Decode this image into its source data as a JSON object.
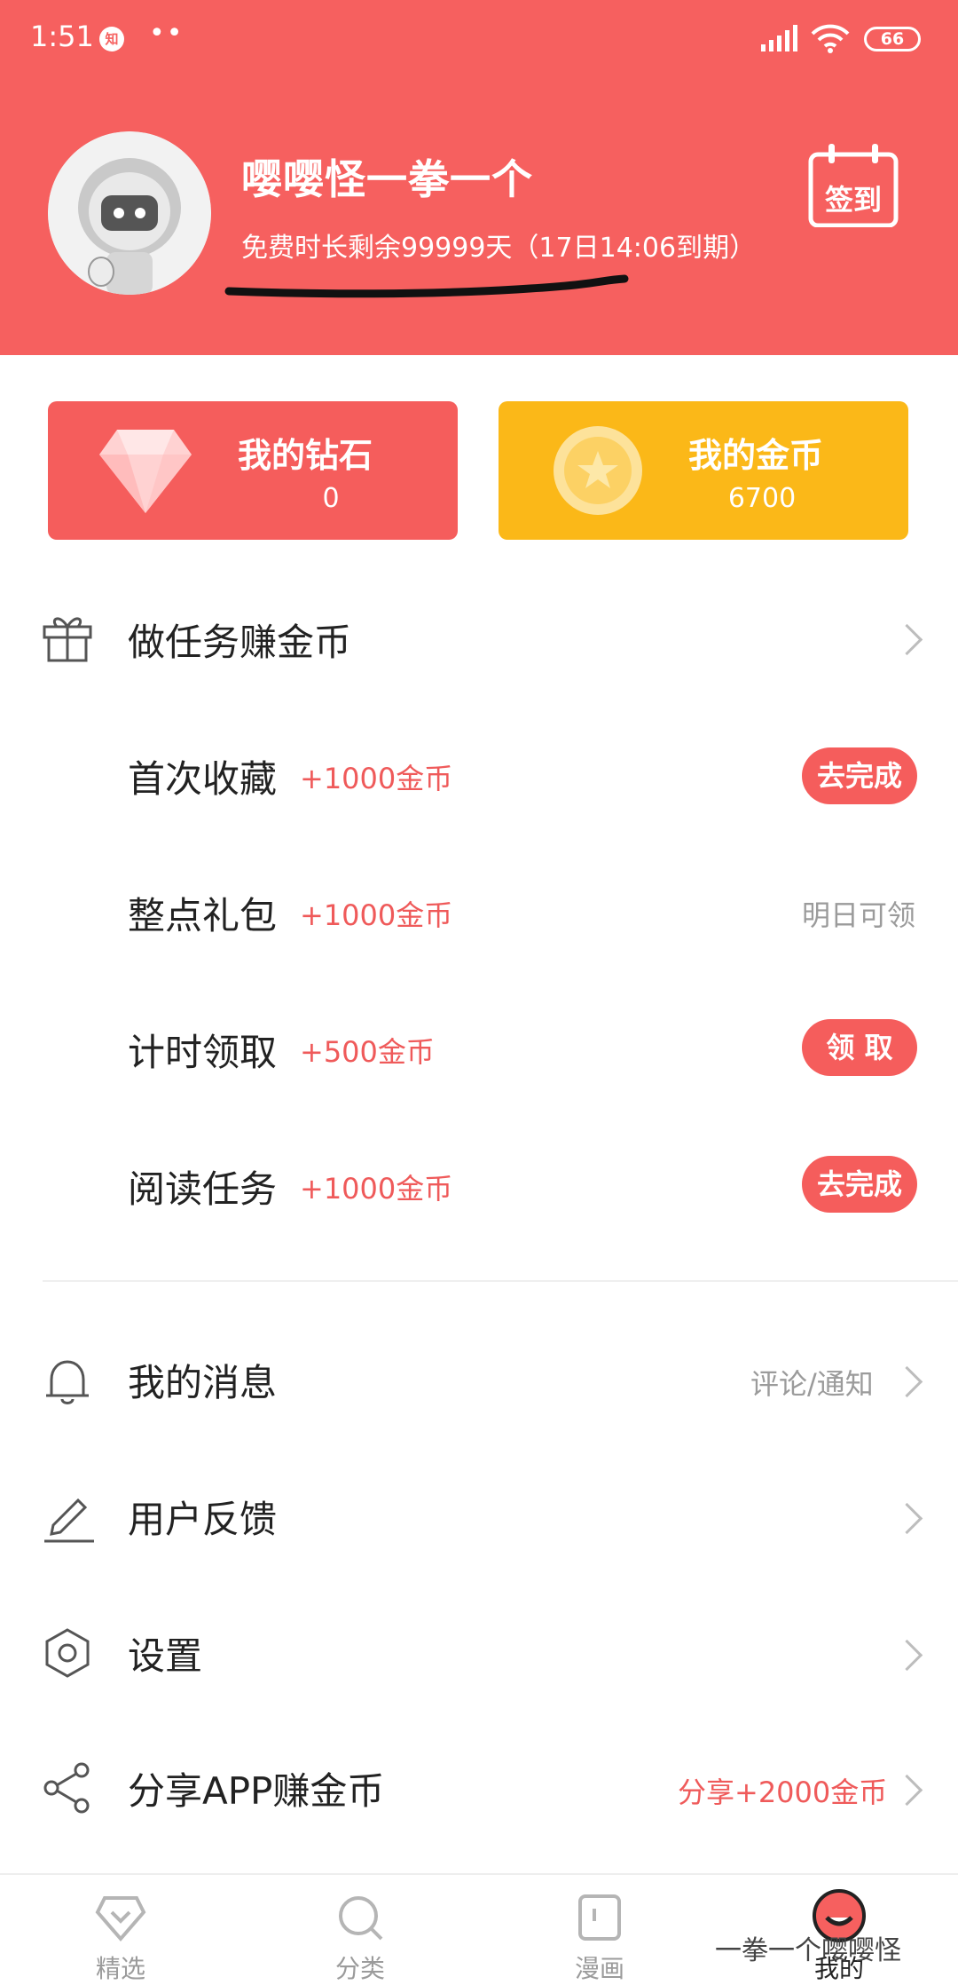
{
  "status_bar": {
    "time": "1:51",
    "badge": "知",
    "dots": "••",
    "battery": "66"
  },
  "profile": {
    "username": "嘤嘤怪一拳一个",
    "expiry": "免费时长剩余99999天（17日14:06到期）",
    "signin_label": "签到"
  },
  "wallet": {
    "diamond": {
      "title": "我的钻石",
      "value": "0"
    },
    "coin": {
      "title": "我的金币",
      "value": "6700"
    }
  },
  "tasks": {
    "header": "做任务赚金币",
    "items": [
      {
        "name": "首次收藏",
        "reward": "+1000金币",
        "action": "去完成"
      },
      {
        "name": "整点礼包",
        "reward": "+1000金币",
        "status": "明日可领"
      },
      {
        "name": "计时领取",
        "reward": "+500金币",
        "action": "领 取"
      },
      {
        "name": "阅读任务",
        "reward": "+1000金币",
        "action": "去完成"
      }
    ]
  },
  "menu": {
    "messages": {
      "label": "我的消息",
      "hint": "评论/通知"
    },
    "feedback": {
      "label": "用户反馈"
    },
    "settings": {
      "label": "设置"
    },
    "share": {
      "label": "分享APP赚金币",
      "hint": "分享+2000金币"
    }
  },
  "bottom_nav": {
    "items": [
      {
        "label": "精选"
      },
      {
        "label": "分类"
      },
      {
        "label": "漫画"
      },
      {
        "label": "我的"
      }
    ]
  },
  "watermark": "一拳一个嘤嘤怪",
  "colors": {
    "brand": "#f6605f",
    "coin": "#fbb818",
    "reward": "#ef5a5a"
  }
}
